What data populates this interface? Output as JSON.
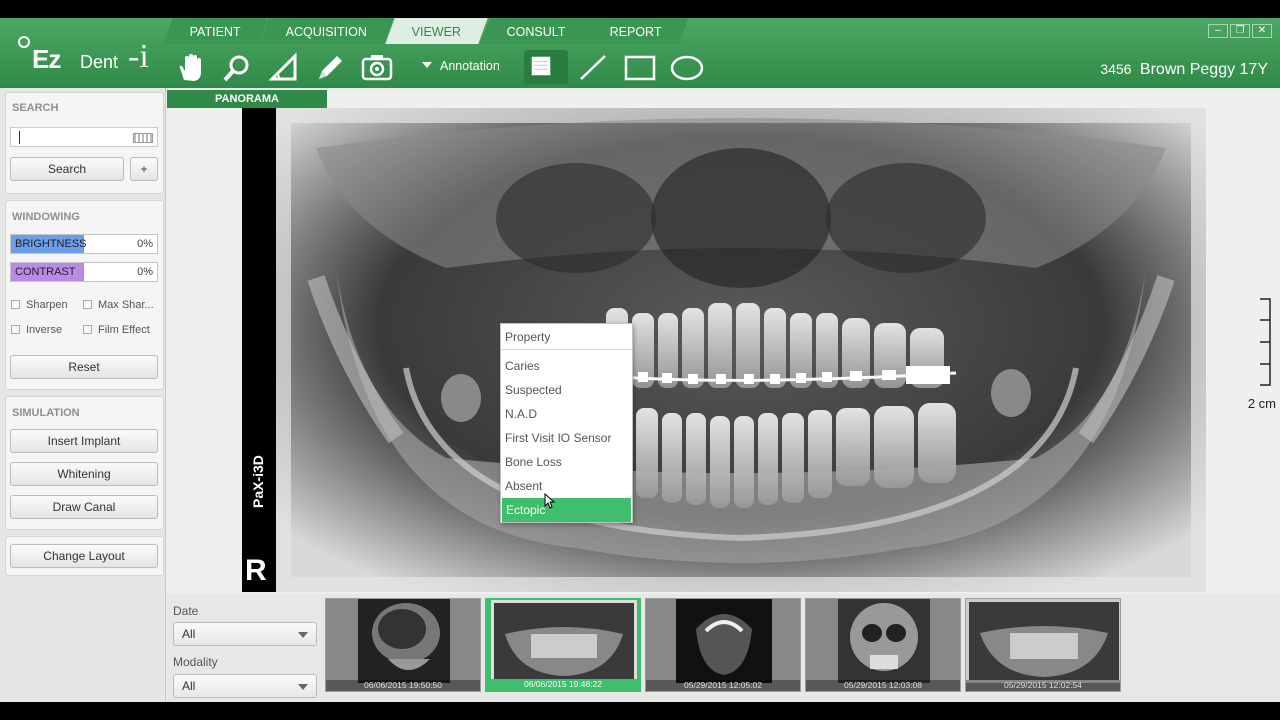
{
  "app": {
    "logo_ez": "Ez",
    "logo_dent": "Dent",
    "logo_i": "-i",
    "window_buttons": [
      "–",
      "❐",
      "✕"
    ]
  },
  "nav": {
    "tabs": [
      "PATIENT",
      "ACQUISITION",
      "VIEWER",
      "CONSULT",
      "REPORT"
    ],
    "active_tab": "VIEWER"
  },
  "toolbar": {
    "tools": [
      "hand-icon",
      "zoom-icon",
      "angle-icon",
      "pencil-icon",
      "capture-icon"
    ],
    "annotation_label": "Annotation",
    "shape_tools": [
      "notepad-icon",
      "line-icon",
      "rectangle-icon",
      "ellipse-icon"
    ]
  },
  "patient": {
    "id": "3456",
    "name": "Brown Peggy 17Y"
  },
  "search": {
    "title": "SEARCH",
    "value": "",
    "button": "Search",
    "add": "+"
  },
  "windowing": {
    "title": "WINDOWING",
    "brightness_label": "BRIGHTNESS",
    "brightness_value": "0%",
    "contrast_label": "CONTRAST",
    "contrast_value": "0%",
    "sharpen": "Sharpen",
    "max_sharpen": "Max Shar...",
    "inverse": "Inverse",
    "film_effect": "Film Effect",
    "reset": "Reset"
  },
  "simulation": {
    "title": "SIMULATION",
    "insert_implant": "Insert Implant",
    "whitening": "Whitening",
    "draw_canal": "Draw Canal"
  },
  "layout": {
    "change_layout": "Change Layout"
  },
  "viewer": {
    "tab": "PANORAMA",
    "device_label": "PaX-i3D",
    "side_marker": "R",
    "scale_label": "2 cm"
  },
  "context_menu": {
    "header": "Property",
    "items": [
      "Caries",
      "Suspected",
      "N.A.D",
      "First Visit IO Sensor",
      "Bone Loss",
      "Absent",
      "Ectopic"
    ],
    "highlighted": "Ectopic"
  },
  "filters": {
    "date_label": "Date",
    "date_value": "All",
    "modality_label": "Modality",
    "modality_value": "All"
  },
  "thumbnails": [
    {
      "timestamp": "06/06/2015 19:50:50",
      "kind": "ceph-lateral"
    },
    {
      "timestamp": "06/06/2015 19:46:22",
      "kind": "panorama",
      "selected": true
    },
    {
      "timestamp": "05/29/2015 12:05:02",
      "kind": "ct-axial"
    },
    {
      "timestamp": "05/29/2015 12:03:08",
      "kind": "ceph-pa"
    },
    {
      "timestamp": "05/29/2015 12:02:54",
      "kind": "panorama"
    }
  ],
  "colors": {
    "brand_green": "#2f8a47",
    "highlight_green": "#3fbf6b",
    "brightness_fill": "#6d9ee8",
    "contrast_fill": "#b98ae6"
  }
}
